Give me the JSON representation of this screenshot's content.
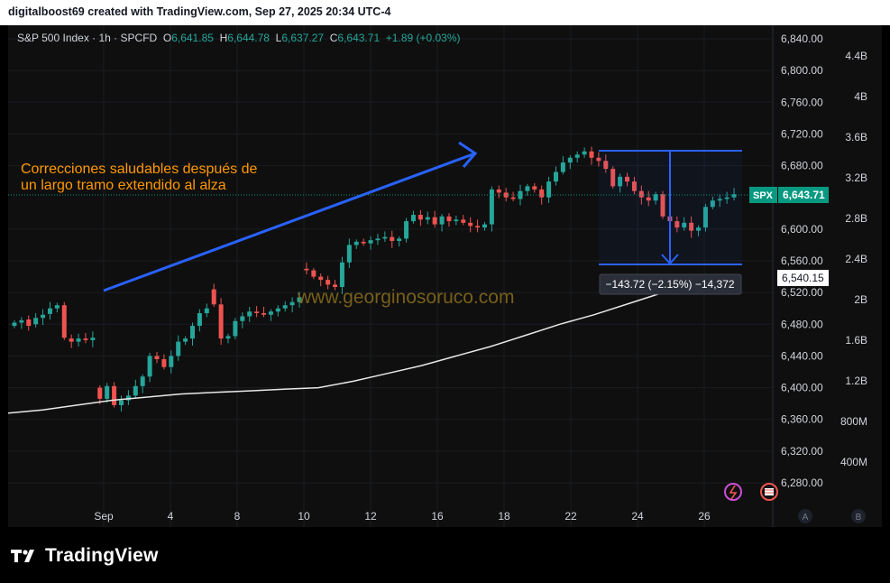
{
  "header": {
    "text": "digitalboost69 created with TradingView.com, Sep 27, 2025 20:34 UTC-4"
  },
  "symbol": {
    "name": "S&P 500 Index · 1h · SPCFD",
    "o_label": "O",
    "o_value": "6,641.85",
    "h_label": "H",
    "h_value": "6,644.78",
    "l_label": "L",
    "l_value": "6,637.27",
    "c_label": "C",
    "c_value": "6,643.71",
    "change": "+1.89 (+0.03%)"
  },
  "annotation": {
    "line1": "Correcciones saludables después de",
    "line2": "un largo tramo extendido al alza",
    "color": "#ff9800"
  },
  "watermark": "www.georginosoruco.com",
  "measure_label": "−143.72 (−2.15%) −14,372",
  "price_tag": {
    "symbol": "SPX",
    "value": "6,643.71",
    "color": "#089981"
  },
  "ma_tag": {
    "value": "6,540.15"
  },
  "footer": {
    "brand": "TradingView"
  },
  "buttons": {
    "a": "A",
    "b": "B"
  },
  "chart_data": {
    "type": "candlestick",
    "y_axis": {
      "min": 6260,
      "max": 6850,
      "ticks": [
        "6,840.00",
        "6,800.00",
        "6,760.00",
        "6,720.00",
        "6,680.00",
        "6,600.00",
        "6,560.00",
        "6,520.00",
        "6,480.00",
        "6,440.00",
        "6,400.00",
        "6,360.00",
        "6,320.00",
        "6,280.00"
      ],
      "tick_values": [
        6840,
        6800,
        6760,
        6720,
        6680,
        6600,
        6560,
        6520,
        6480,
        6440,
        6400,
        6360,
        6320,
        6280
      ]
    },
    "volume_axis": {
      "ticks": [
        "4.4B",
        "4B",
        "3.6B",
        "3.2B",
        "2.8B",
        "2.4B",
        "2B",
        "1.6B",
        "1.2B",
        "800M",
        "400M"
      ],
      "tick_values": [
        4.4,
        4.0,
        3.6,
        3.2,
        2.8,
        2.4,
        2.0,
        1.6,
        1.2,
        0.8,
        0.4
      ]
    },
    "x_axis": {
      "ticks": [
        "Sep",
        "4",
        "8",
        "10",
        "12",
        "16",
        "18",
        "22",
        "24",
        "26"
      ],
      "tick_positions": [
        0,
        1,
        2,
        3,
        4,
        5,
        6,
        7,
        8,
        9
      ]
    },
    "up_color": "#26a69a",
    "down_color": "#ef5350",
    "closes": [
      6482,
      6485,
      6478,
      6488,
      6492,
      6500,
      6504,
      6463,
      6458,
      6462,
      6460,
      6463,
      6386,
      6402,
      6378,
      6384,
      6390,
      6402,
      6414,
      6440,
      6436,
      6426,
      6440,
      6458,
      6462,
      6478,
      6494,
      6500,
      6505,
      6462,
      6465,
      6484,
      6490,
      6496,
      6494,
      6492,
      6496,
      6500,
      6504,
      6508,
      6514,
      6548,
      6540,
      6536,
      6530,
      6527,
      6558,
      6580,
      6584,
      6582,
      6586,
      6588,
      6590,
      6585,
      6588,
      6610,
      6618,
      6612,
      6615,
      6606,
      6616,
      6610,
      6612,
      6608,
      6604,
      6602,
      6606,
      6650,
      6646,
      6640,
      6638,
      6648,
      6654,
      6650,
      6640,
      6660,
      6672,
      6684,
      6690,
      6694,
      6698,
      6690,
      6686,
      6676,
      6654,
      6666,
      6660,
      6648,
      6640,
      6636,
      6644,
      6616,
      6610,
      6602,
      6608,
      6598,
      6602,
      6628,
      6636,
      6638,
      6640,
      6644
    ],
    "opens": [
      6478,
      6482,
      6486,
      6480,
      6488,
      6493,
      6500,
      6504,
      6462,
      6458,
      6462,
      6460,
      6400,
      6386,
      6402,
      6378,
      6384,
      6390,
      6402,
      6414,
      6440,
      6436,
      6426,
      6440,
      6458,
      6462,
      6478,
      6494,
      6524,
      6505,
      6462,
      6465,
      6484,
      6490,
      6496,
      6494,
      6492,
      6496,
      6500,
      6504,
      6508,
      6550,
      6548,
      6540,
      6536,
      6530,
      6527,
      6558,
      6580,
      6584,
      6582,
      6586,
      6588,
      6590,
      6585,
      6588,
      6610,
      6618,
      6612,
      6615,
      6606,
      6616,
      6610,
      6612,
      6608,
      6604,
      6602,
      6606,
      6650,
      6646,
      6640,
      6638,
      6648,
      6654,
      6650,
      6640,
      6660,
      6672,
      6684,
      6690,
      6694,
      6698,
      6690,
      6686,
      6676,
      6654,
      6666,
      6660,
      6648,
      6640,
      6636,
      6644,
      6616,
      6610,
      6602,
      6608,
      6598,
      6602,
      6628,
      6636,
      6638,
      6640
    ],
    "ma_series": [
      6368,
      6372,
      6378,
      6384,
      6388,
      6392,
      6394,
      6396,
      6398,
      6400,
      6408,
      6418,
      6428,
      6440,
      6452,
      6466,
      6480,
      6492,
      6506,
      6520,
      6532,
      6540
    ]
  }
}
